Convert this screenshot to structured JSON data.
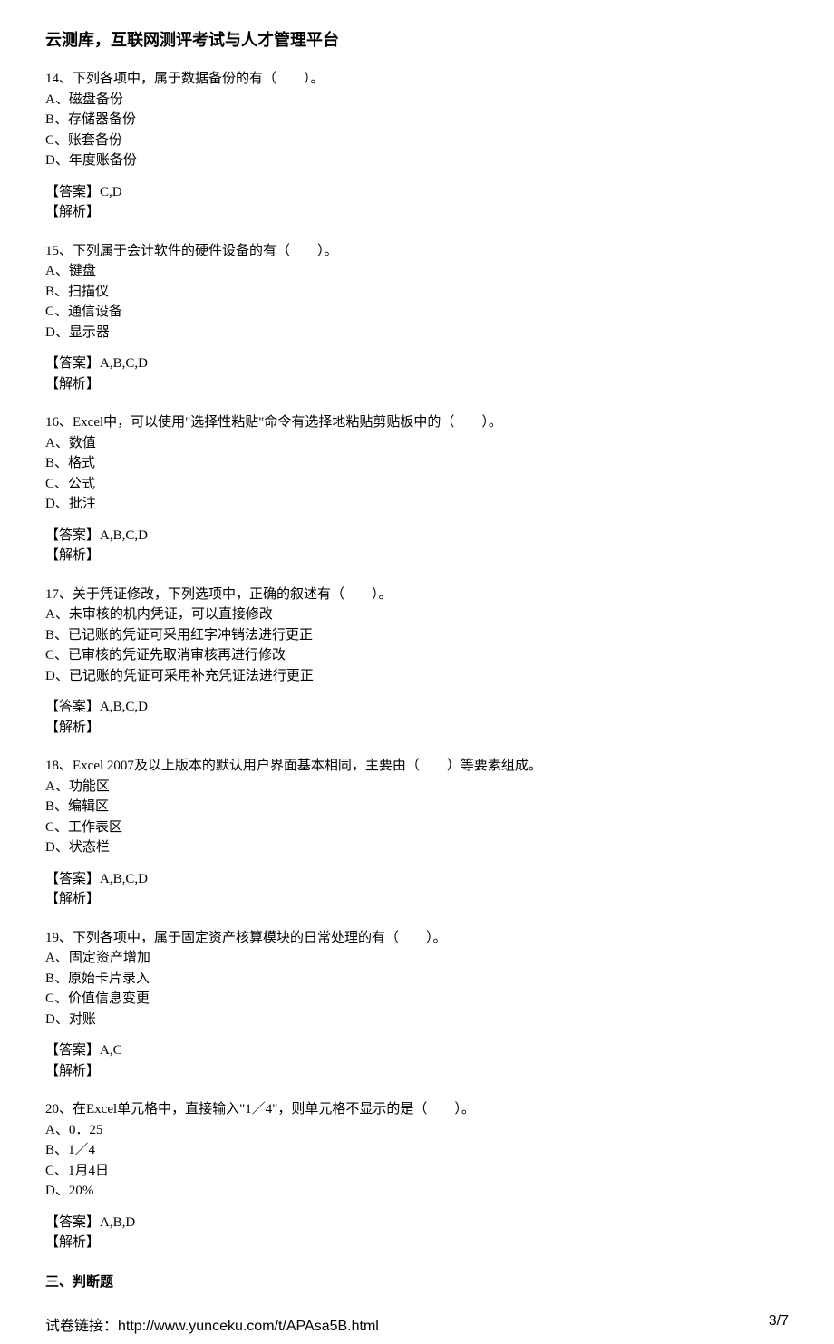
{
  "header": {
    "title": "云测库，互联网测评考试与人才管理平台"
  },
  "questions": [
    {
      "stem": "14、下列各项中，属于数据备份的有（　　）。",
      "options": [
        "A、磁盘备份",
        "B、存储器备份",
        "C、账套备份",
        "D、年度账备份"
      ],
      "answer_label": "【答案】",
      "answer_value": "C,D",
      "explain_label": "【解析】"
    },
    {
      "stem": "15、下列属于会计软件的硬件设备的有（　　）。",
      "options": [
        "A、键盘",
        "B、扫描仪",
        "C、通信设备",
        "D、显示器"
      ],
      "answer_label": "【答案】",
      "answer_value": "A,B,C,D",
      "explain_label": "【解析】"
    },
    {
      "stem": "16、Excel中，可以使用\"选择性粘贴\"命令有选择地粘贴剪贴板中的（　　）。",
      "options": [
        "A、数值",
        "B、格式",
        "C、公式",
        "D、批注"
      ],
      "answer_label": "【答案】",
      "answer_value": "A,B,C,D",
      "explain_label": "【解析】"
    },
    {
      "stem": "17、关于凭证修改，下列选项中，正确的叙述有（　　）。",
      "options": [
        "A、未审核的机内凭证，可以直接修改",
        "B、已记账的凭证可采用红字冲销法进行更正",
        "C、已审核的凭证先取消审核再进行修改",
        "D、已记账的凭证可采用补充凭证法进行更正"
      ],
      "answer_label": "【答案】",
      "answer_value": "A,B,C,D",
      "explain_label": "【解析】"
    },
    {
      "stem": "18、Excel 2007及以上版本的默认用户界面基本相同，主要由（　　）等要素组成。",
      "options": [
        "A、功能区",
        "B、编辑区",
        "C、工作表区",
        "D、状态栏"
      ],
      "answer_label": "【答案】",
      "answer_value": "A,B,C,D",
      "explain_label": "【解析】"
    },
    {
      "stem": "19、下列各项中，属于固定资产核算模块的日常处理的有（　　）。",
      "options": [
        "A、固定资产增加",
        "B、原始卡片录入",
        "C、价值信息变更",
        "D、对账"
      ],
      "answer_label": "【答案】",
      "answer_value": "A,C",
      "explain_label": "【解析】"
    },
    {
      "stem": "20、在Excel单元格中，直接输入\"1／4\"，则单元格不显示的是（　　）。",
      "options": [
        "A、0．25",
        "B、1／4",
        "C、1月4日",
        "D、20%"
      ],
      "answer_label": "【答案】",
      "answer_value": "A,B,D",
      "explain_label": "【解析】"
    }
  ],
  "section": {
    "title": "三、判断题"
  },
  "footer": {
    "url_label": "试卷链接：",
    "url": "http://www.yunceku.com/t/APAsa5B.html",
    "page": "3/7"
  }
}
